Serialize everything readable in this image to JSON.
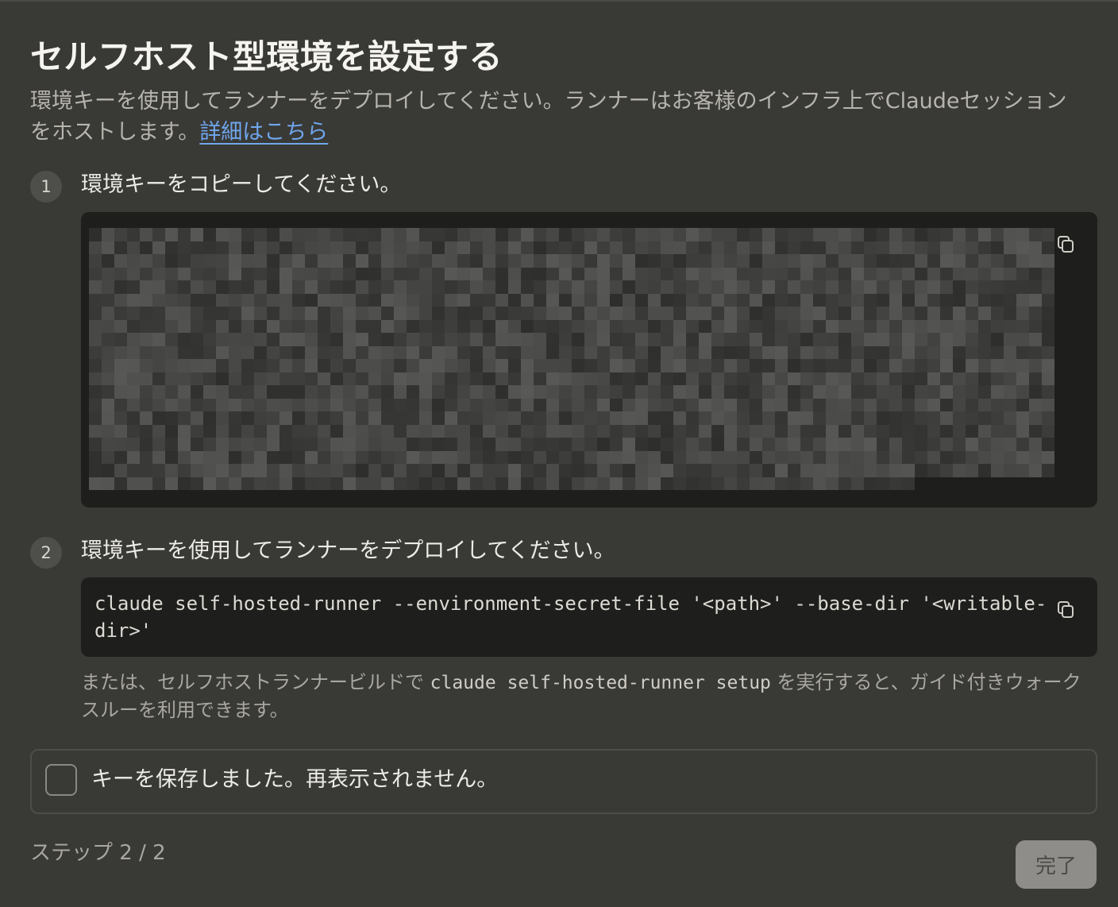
{
  "dialog": {
    "title": "セルフホスト型環境を設定する",
    "description": "環境キーを使用してランナーをデプロイしてください。ランナーはお客様のインフラ上でClaudeセッションをホストします。",
    "learn_more_link": "詳細はこちら"
  },
  "steps": [
    {
      "number": "1",
      "label": "環境キーをコピーしてください。",
      "copy_icon": "copy-icon"
    },
    {
      "number": "2",
      "label": "環境キーを使用してランナーをデプロイしてください。",
      "command": "claude self-hosted-runner --environment-secret-file '<path>' --base-dir '<writable-dir>'",
      "copy_icon": "copy-icon"
    }
  ],
  "alt_note": {
    "prefix": "または、セルフホストランナービルドで",
    "code": "claude self-hosted-runner setup",
    "suffix": "を実行すると、ガイド付きウォークスルーを利用できます。"
  },
  "confirm": {
    "label": "キーを保存しました。再表示されません。",
    "checked": false
  },
  "footer": {
    "step_counter": "ステップ 2 / 2",
    "done_label": "完了"
  },
  "colors": {
    "background": "#393936",
    "code_background": "#1e1e1c",
    "link": "#6fa6ec",
    "done_button": "#8e8d89"
  }
}
